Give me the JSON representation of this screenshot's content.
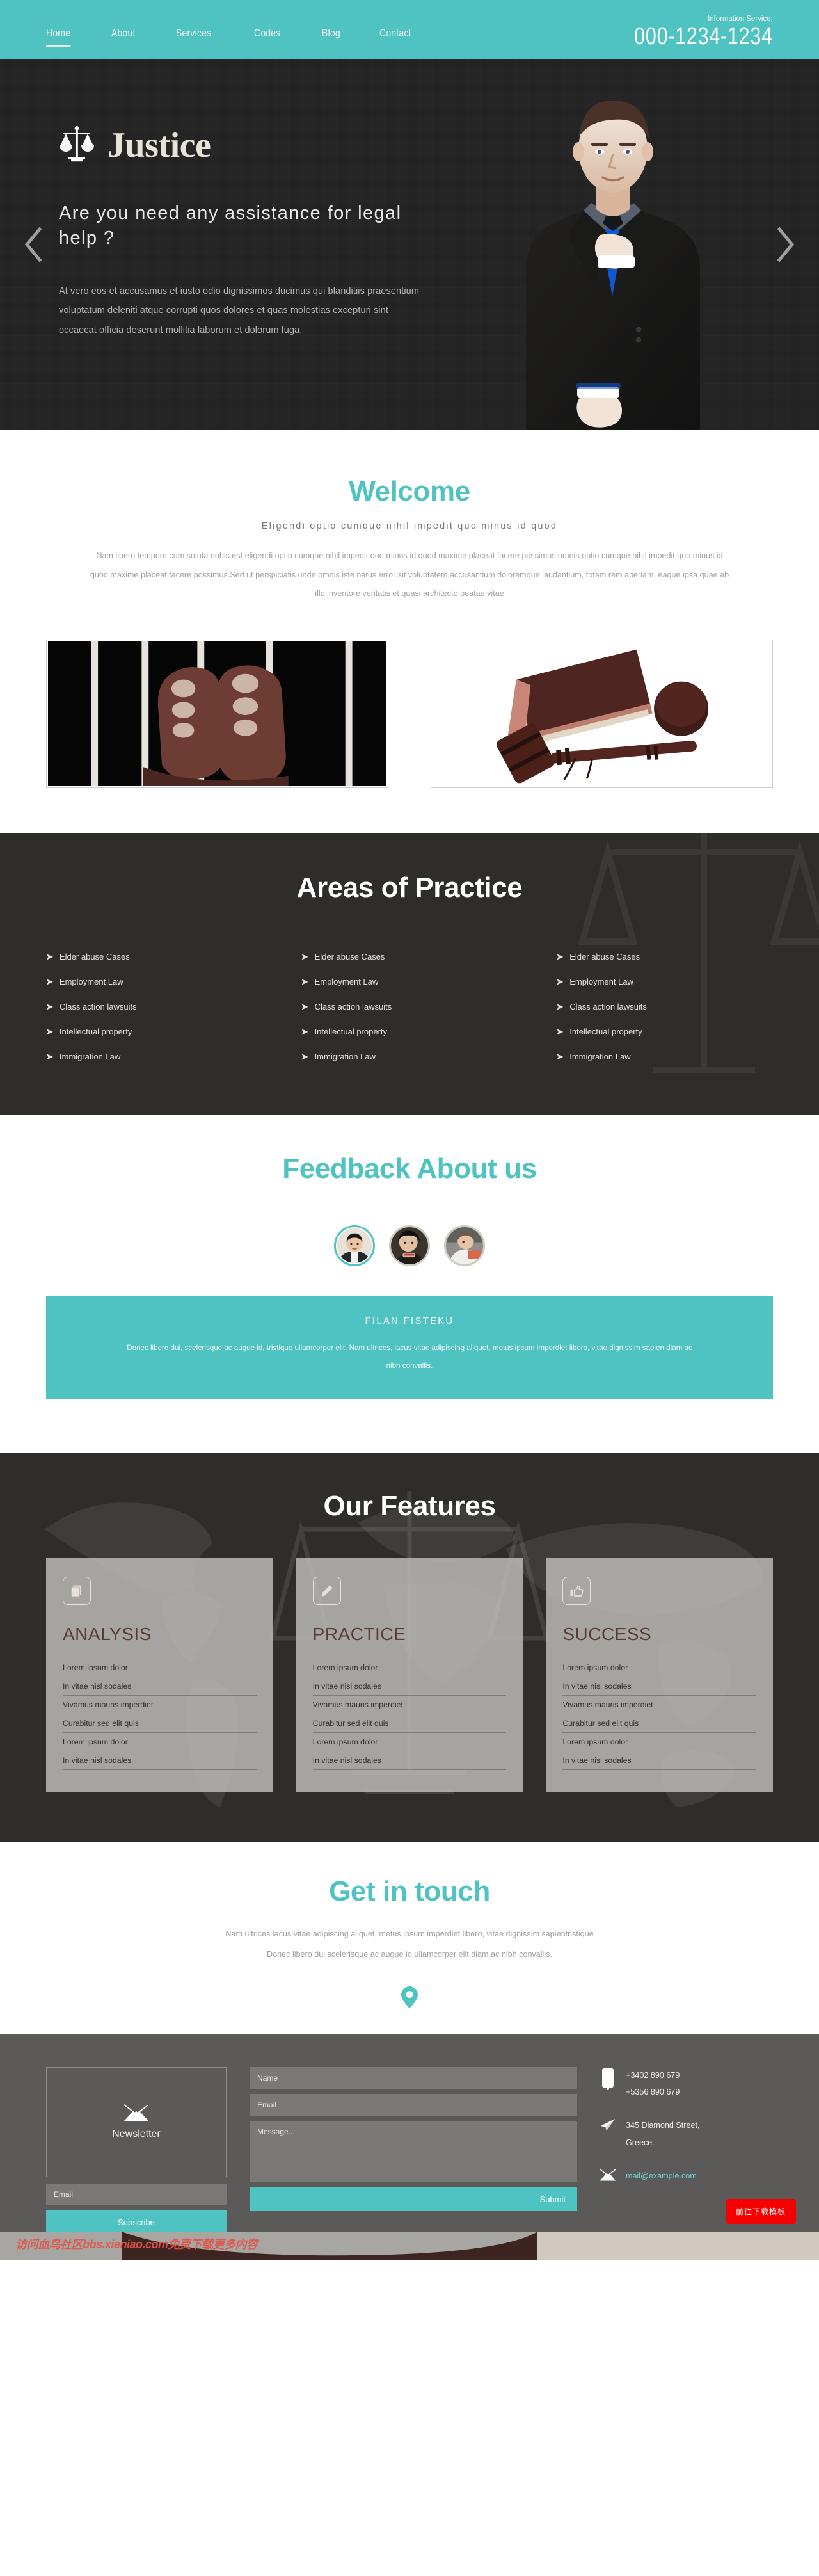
{
  "header": {
    "nav": [
      {
        "label": "Home",
        "active": true
      },
      {
        "label": "About",
        "active": false
      },
      {
        "label": "Services",
        "active": false
      },
      {
        "label": "Codes",
        "active": false
      },
      {
        "label": "Blog",
        "active": false
      },
      {
        "label": "Contact",
        "active": false
      }
    ],
    "info_label": "Information Service:",
    "phone": "000-1234-1234"
  },
  "hero": {
    "brand": "Justice",
    "headline": "Are you need any assistance for legal help ?",
    "body": "At vero eos et accusamus et iusto odio dignissimos ducimus qui blanditiis praesentium voluptatum deleniti atque corrupti quos dolores et quas molestias excepturi sint occaecat officia deserunt mollitia laborum et dolorum fuga.",
    "prev_label": "Previous slide",
    "next_label": "Next slide"
  },
  "welcome": {
    "title": "Welcome",
    "subtitle": "Eligendi optio cumque nihil impedit quo minus id quod",
    "paragraph": "Nam libero tempore cum soluta nobis est eligendi optio cumque nihil impedit quo minus id quod maxime placeat facere possimus omnis optio cumque nihil impedit quo minus id quod maxime placeat facere possimus.Sed ut perspiciatis unde omnis iste natus error sit voluptatem accusantium doloremque laudantium, totam rem aperiam, eaque ipsa quae ab illo inventore veritatis et quasi architecto beatae vitae",
    "image_left_alt": "hands-gripping-prison-bars",
    "image_right_alt": "gavel-and-law-book"
  },
  "areas": {
    "title": "Areas of Practice",
    "columns": [
      [
        "Elder abuse Cases",
        "Employment Law",
        "Class action lawsuits",
        "Intellectual property",
        "Immigration Law"
      ],
      [
        "Elder abuse Cases",
        "Employment Law",
        "Class action lawsuits",
        "Intellectual property",
        "Immigration Law"
      ],
      [
        "Elder abuse Cases",
        "Employment Law",
        "Class action lawsuits",
        "Intellectual property",
        "Immigration Law"
      ]
    ]
  },
  "feedback": {
    "title": "Feedback About us",
    "avatars": [
      {
        "alt": "testimonial-avatar-1",
        "active": true
      },
      {
        "alt": "testimonial-avatar-2",
        "active": false
      },
      {
        "alt": "testimonial-avatar-3",
        "active": false
      }
    ],
    "quote_name": "FILAN FISTEKU",
    "quote_text": "Donec libero dui, scelerisque ac augue id, tristique ullamcorper elit. Nam ultrices, lacus vitae adipiscing aliquet, metus ipsum imperdiet libero, vitae dignissim sapien diam ac nibh convallis."
  },
  "features": {
    "title": "Our Features",
    "cards": [
      {
        "icon": "book-icon",
        "title": "ANALYSIS",
        "items": [
          "Lorem ipsum dolor",
          "In vitae nisl sodales",
          "Vivamus mauris imperdiet",
          "Curabitur sed elit quis",
          "Lorem ipsum dolor",
          "In vitae nisl sodales"
        ]
      },
      {
        "icon": "pencil-icon",
        "title": "PRACTICE",
        "items": [
          "Lorem ipsum dolor",
          "In vitae nisl sodales",
          "Vivamus mauris imperdiet",
          "Curabitur sed elit quis",
          "Lorem ipsum dolor",
          "In vitae nisl sodales"
        ]
      },
      {
        "icon": "thumbs-up-icon",
        "title": "SUCCESS",
        "items": [
          "Lorem ipsum dolor",
          "In vitae nisl sodales",
          "Vivamus mauris imperdiet",
          "Curabitur sed elit quis",
          "Lorem ipsum dolor",
          "In vitae nisl sodales"
        ]
      }
    ]
  },
  "touch": {
    "title": "Get in touch",
    "line1": "Nam ultrices lacus vitae adipiscing aliquet, metus ipsum imperdiet libero, vitae dignissim sapientristique",
    "line2": "Donec libero dui scelerisque ac augue id ullamcorper elit diam ac nibh convallis."
  },
  "footer": {
    "newsletter_label": "Newsletter",
    "newsletter_email_placeholder": "Email",
    "subscribe_label": "Subscribe",
    "name_placeholder": "Name",
    "email_placeholder": "Email",
    "message_placeholder": "Message...",
    "submit_label": "Submit",
    "phone1": "+3402 890 679",
    "phone2": "+5356 890 679",
    "address1": "345 Diamond Street,",
    "address2": "Greece.",
    "email": "mail@example.com",
    "download_button": "前往下载模板",
    "watermark": "访问血鸟社区bbs.xieniao.com免费下载更多内容"
  },
  "colors": {
    "accent": "#4ec3c1",
    "dark": "#2e2d2b",
    "hero_dark": "#232323",
    "footer": "#5b5a58",
    "card_title": "#5a3b33",
    "download_red": "#f40000"
  }
}
